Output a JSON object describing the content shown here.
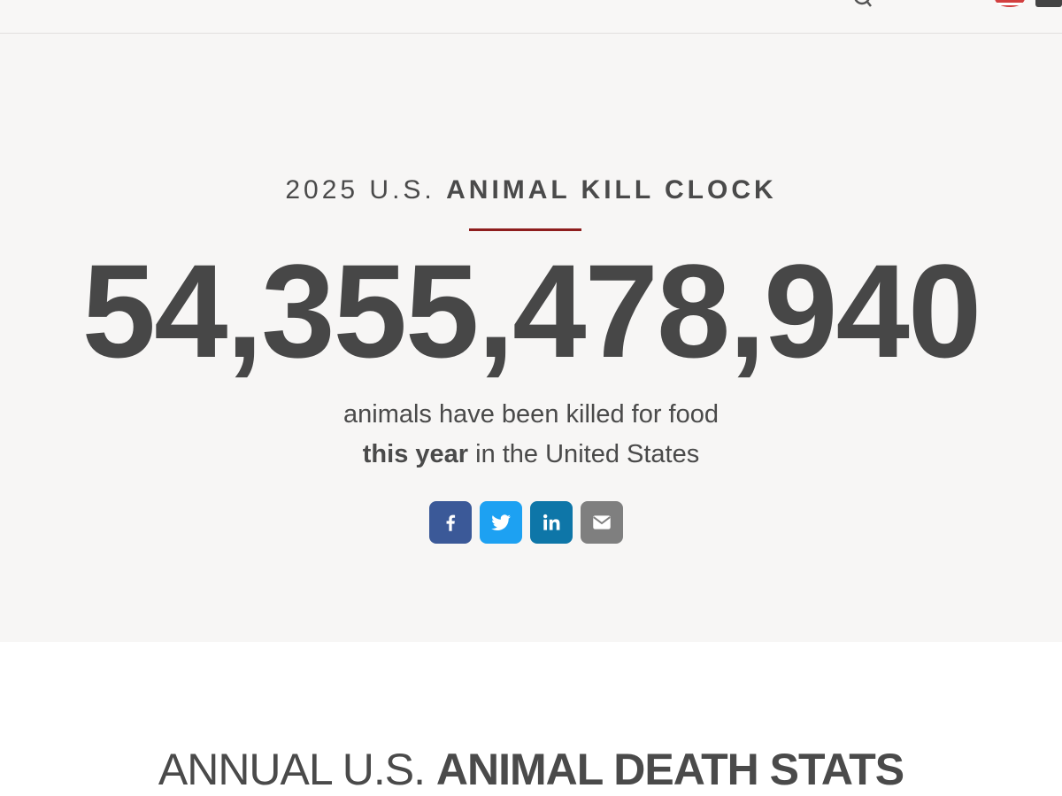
{
  "header": {
    "icons": [
      "search-icon",
      "us-flag-icon",
      "language-icon"
    ]
  },
  "hero": {
    "kicker_light": "2025 U.S.",
    "kicker_bold": "ANIMAL KILL CLOCK",
    "counter": "54,355,478,940",
    "caption_line1": "animals have been killed for food",
    "caption_bold": "this year",
    "caption_line2_rest": " in the United States",
    "rule_color": "#8e1d1d"
  },
  "share_buttons": [
    {
      "icon": "facebook-icon",
      "color": "#3b5998"
    },
    {
      "icon": "twitter-icon",
      "color": "#1da1f2"
    },
    {
      "icon": "linkedin-icon",
      "color": "#0e76a8"
    },
    {
      "icon": "email-icon",
      "color": "#7f7f7f"
    }
  ],
  "stats_section": {
    "title_light": "ANNUAL U.S.",
    "title_bold": "ANIMAL DEATH STATS"
  }
}
